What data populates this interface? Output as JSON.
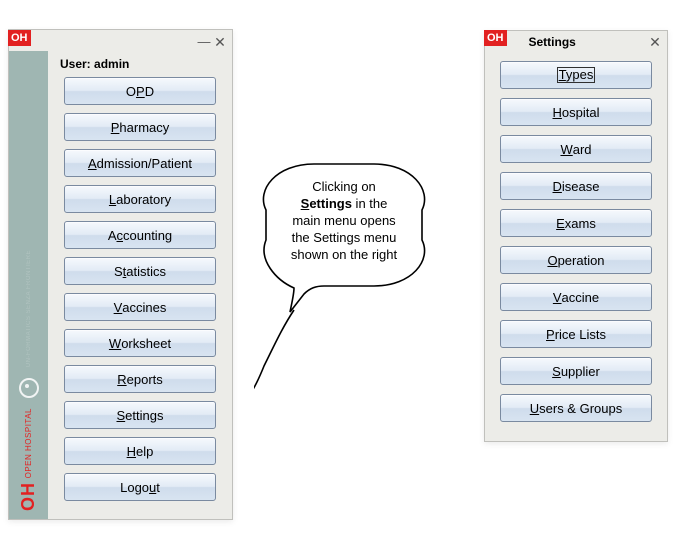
{
  "brand": {
    "badge": "OH",
    "vert": "OH",
    "vert_sub": "OPEN HOSPITAL",
    "tagline": "UN-FORMATICS SENZA FRONTIERE"
  },
  "main_window": {
    "user_prefix": "User: ",
    "user_name": "admin",
    "items": [
      {
        "pre": "O",
        "mn": "P",
        "post": "D"
      },
      {
        "pre": "",
        "mn": "P",
        "post": "harmacy"
      },
      {
        "pre": "",
        "mn": "A",
        "post": "dmission/Patient"
      },
      {
        "pre": "",
        "mn": "L",
        "post": "aboratory"
      },
      {
        "pre": "A",
        "mn": "c",
        "post": "counting"
      },
      {
        "pre": "S",
        "mn": "t",
        "post": "atistics"
      },
      {
        "pre": "",
        "mn": "V",
        "post": "accines"
      },
      {
        "pre": "",
        "mn": "W",
        "post": "orksheet"
      },
      {
        "pre": "",
        "mn": "R",
        "post": "eports"
      },
      {
        "pre": "",
        "mn": "S",
        "post": "ettings"
      },
      {
        "pre": "",
        "mn": "H",
        "post": "elp"
      },
      {
        "pre": "Logo",
        "mn": "u",
        "post": "t"
      }
    ]
  },
  "settings_window": {
    "title": "Settings",
    "items": [
      {
        "pre": "",
        "mn": "T",
        "post": "ypes",
        "boxed": true
      },
      {
        "pre": "",
        "mn": "H",
        "post": "ospital"
      },
      {
        "pre": "",
        "mn": "W",
        "post": "ard"
      },
      {
        "pre": "",
        "mn": "D",
        "post": "isease"
      },
      {
        "pre": "",
        "mn": "E",
        "post": "xams"
      },
      {
        "pre": "",
        "mn": "O",
        "post": "peration"
      },
      {
        "pre": "",
        "mn": "V",
        "post": "accine"
      },
      {
        "pre": "",
        "mn": "P",
        "post": "rice Lists"
      },
      {
        "pre": "",
        "mn": "S",
        "post": "upplier"
      },
      {
        "pre": "",
        "mn": "U",
        "post": "sers & Groups"
      }
    ]
  },
  "callout": {
    "line1": "Clicking on",
    "bold_pre": "",
    "bold_mn": "S",
    "bold_post": "ettings",
    "line2a": " in the",
    "line3": "main menu opens",
    "line4": "the Settings menu",
    "line5": "shown on the right"
  },
  "icons": {
    "minimize": "—",
    "close": "✕"
  }
}
